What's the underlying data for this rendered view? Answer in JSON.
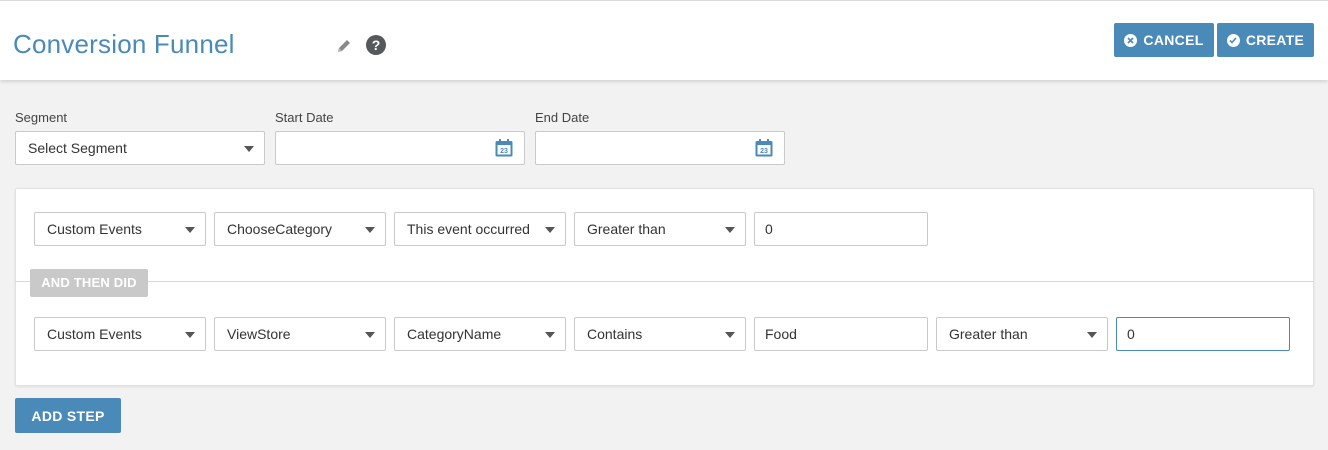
{
  "header": {
    "title": "Conversion Funnel",
    "help_glyph": "?",
    "cancel_label": "CANCEL",
    "create_label": "CREATE"
  },
  "filters": {
    "segment_label": "Segment",
    "segment_value": "Select Segment",
    "start_date_label": "Start Date",
    "start_date_value": "",
    "end_date_label": "End Date",
    "end_date_value": "",
    "calendar_day": "23"
  },
  "steps": [
    {
      "category": "Custom Events",
      "event": "ChooseCategory",
      "condition": "This event occurred",
      "operator": "Greater than",
      "value": "0"
    },
    {
      "category": "Custom Events",
      "event": "ViewStore",
      "property": "CategoryName",
      "property_operator": "Contains",
      "property_value": "Food",
      "operator": "Greater than",
      "value": "0"
    }
  ],
  "connector_label": "AND THEN DID",
  "add_step_label": "ADD STEP",
  "colors": {
    "accent": "#4a8ab9",
    "badge": "#c9c9c9",
    "background": "#f1f2f1"
  },
  "icons": {
    "edit": "pencil-icon",
    "help": "question-icon",
    "cancel": "x-circle-icon",
    "create": "check-circle-icon",
    "calendar": "calendar-icon",
    "dropdown": "chevron-down-icon"
  }
}
